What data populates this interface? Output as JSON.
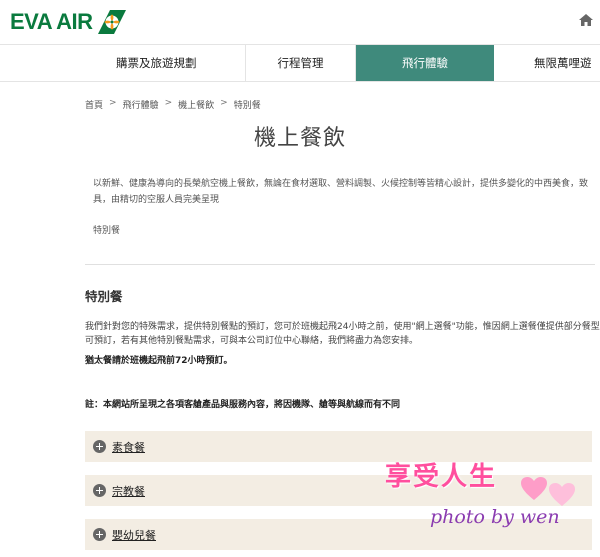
{
  "brand": {
    "name": "EVA AIR",
    "color": "#0a7a3e"
  },
  "nav": {
    "items": [
      {
        "label": "購票及旅遊規劃"
      },
      {
        "label": "行程管理"
      },
      {
        "label": "飛行體驗",
        "active": true
      },
      {
        "label": "無限萬哩遊"
      }
    ],
    "active_color": "#3f8a7c"
  },
  "breadcrumb": {
    "items": [
      "首頁",
      "飛行體驗",
      "機上餐飲",
      "特別餐"
    ],
    "separator": ">"
  },
  "page": {
    "title": "機上餐飲",
    "intro": "以新鮮、健康為導向的長榮航空機上餐飲，無論在食材選取、營料調製、火候控制等皆精心設計，提供多變化的中西美食，致具，由精切的空服人員完美呈現",
    "sub_link": "特別餐"
  },
  "section": {
    "title": "特別餐",
    "description": "我們針對您的特殊需求，提供特別餐點的預訂，您可於班機起飛24小時之前，使用\"網上選餐\"功能，惟因網上選餐僅提供部分餐型可預訂，若有其他特別餐點需求，可與本公司訂位中心聯絡，我們將盡力為您安排。",
    "notice": "猶太餐請於班機起飛前72小時預訂。",
    "note": "註：本網站所呈現之各項客艙產品與服務內容，將因機隊、艙等與航線而有不同"
  },
  "accordion": {
    "items": [
      "素食餐",
      "宗教餐",
      "嬰幼兒餐"
    ],
    "background": "#f3ede3"
  },
  "watermark": {
    "title": "享受人生",
    "subtitle": "photo by wen"
  },
  "icons": {
    "home": "home-icon",
    "expand": "plus-circle-icon"
  }
}
